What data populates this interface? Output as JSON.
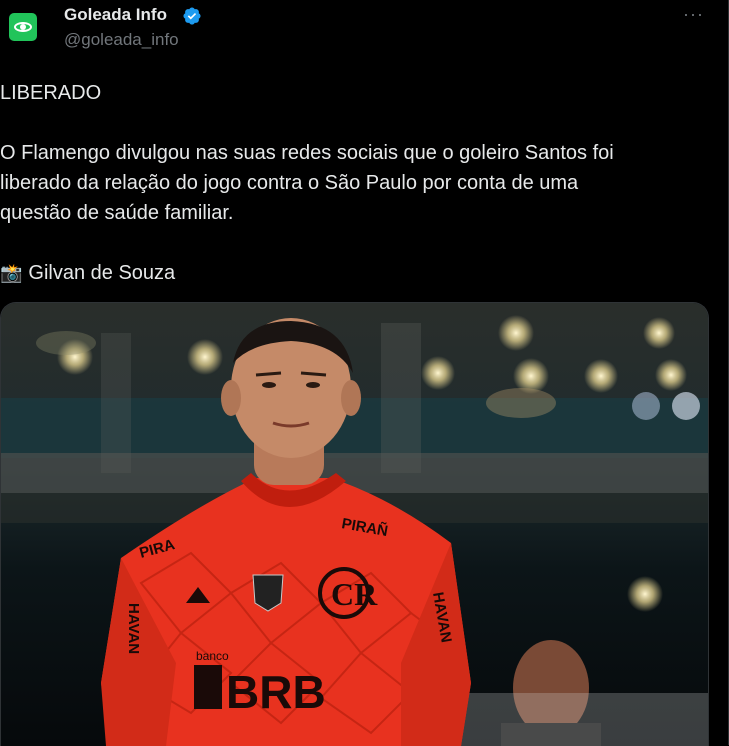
{
  "author": {
    "name": "Goleada Info",
    "handle": "@goleada_info",
    "verified_color": "#1d9bf0",
    "avatar_color": "#21c45a",
    "avatar_icon": "goleada-logo-icon"
  },
  "menu": {
    "more_label": "···"
  },
  "tweet": {
    "headline": "LIBERADO",
    "body_line1": "O Flamengo divulgou nas suas redes sociais que o goleiro Santos foi",
    "body_line2": "liberado da relação do jogo contra o São Paulo por conta de uma",
    "body_line3": "questão de saúde familiar.",
    "credit_emoji": "📸",
    "credit": "Gilvan de Souza"
  },
  "media": {
    "shirt_sponsor": "BRB",
    "shirt_sponsor_small": "banco",
    "shirt_brand_left": "PIRA",
    "shirt_brand_right": "PIRAÑ",
    "sleeve_text_left": "HAVAN",
    "sleeve_text_right": "HAVAN",
    "jersey_color": "#e8321f"
  }
}
